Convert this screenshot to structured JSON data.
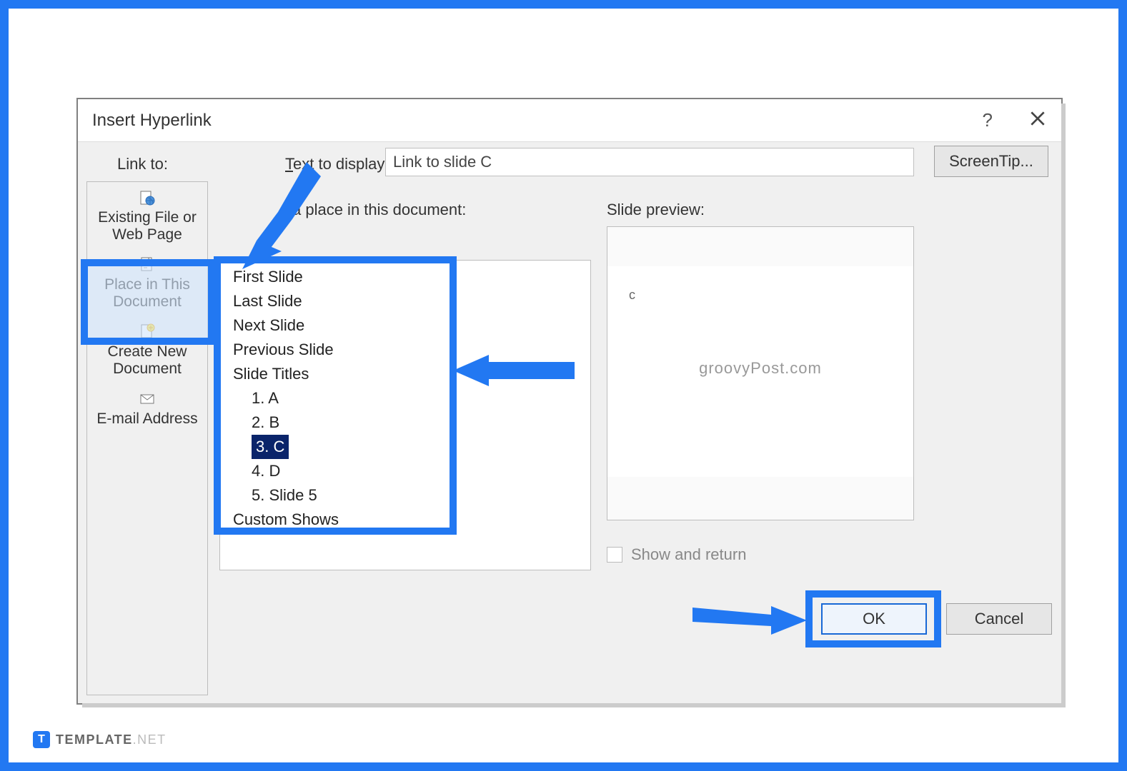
{
  "dialog": {
    "title": "Insert Hyperlink",
    "linkto_label": "Link to:",
    "text_to_display_label": "Text to display:",
    "text_to_display_value": "Link to slide C",
    "screentip_label": "ScreenTip...",
    "place_label": "a place in this document:",
    "preview_label": "Slide preview:",
    "show_return_label": "Show and return",
    "ok_label": "OK",
    "cancel_label": "Cancel"
  },
  "sidebar": {
    "items": [
      {
        "label_line1": "Existing File or",
        "label_line2": "Web Page",
        "icon": "globe-page-icon"
      },
      {
        "label_line1": "Place in This",
        "label_line2": "Document",
        "icon": "doc-icon",
        "selected": true
      },
      {
        "label_line1": "Create New",
        "label_line2": "Document",
        "icon": "newdoc-icon"
      },
      {
        "label_line1": "E-mail Address",
        "label_line2": "",
        "icon": "mail-icon"
      }
    ]
  },
  "tree": {
    "items": [
      {
        "indent": 0,
        "label": "First Slide"
      },
      {
        "indent": 0,
        "label": "Last Slide"
      },
      {
        "indent": 0,
        "label": "Next Slide"
      },
      {
        "indent": 0,
        "label": "Previous Slide"
      },
      {
        "indent": 0,
        "label": "Slide Titles"
      },
      {
        "indent": 1,
        "label": "1. A"
      },
      {
        "indent": 1,
        "label": "2. B"
      },
      {
        "indent": 1,
        "label": "3. C",
        "selected": true
      },
      {
        "indent": 1,
        "label": "4. D"
      },
      {
        "indent": 1,
        "label": "5. Slide 5"
      },
      {
        "indent": 0,
        "label": "Custom Shows"
      }
    ]
  },
  "preview": {
    "slide_corner_text": "c",
    "watermark": "groovyPost.com"
  },
  "branding": {
    "logo_letter": "T",
    "name": "TEMPLATE",
    "suffix": ".NET"
  }
}
